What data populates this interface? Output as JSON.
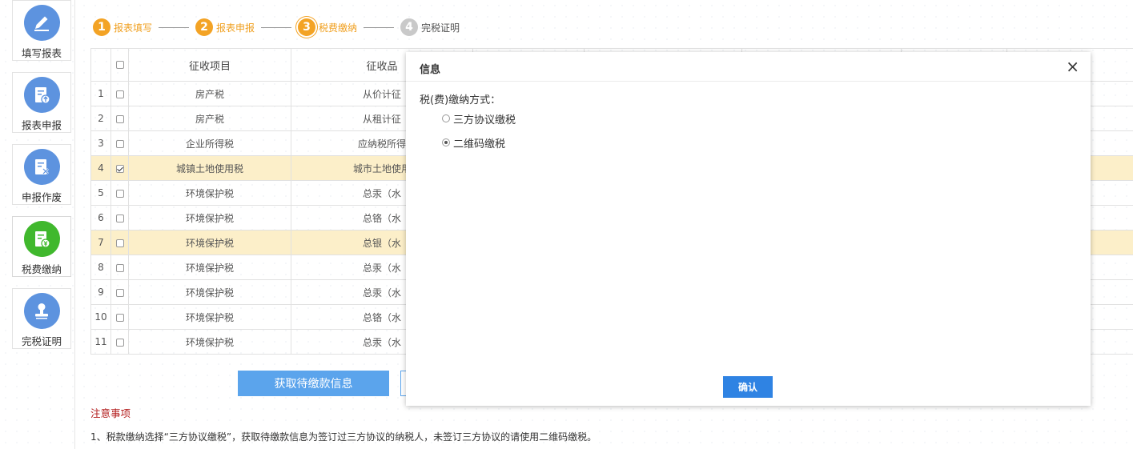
{
  "sidebar": {
    "items": [
      {
        "label": "填写报表",
        "icon": "pen-icon"
      },
      {
        "label": "报表申报",
        "icon": "upload-report-icon"
      },
      {
        "label": "申报作废",
        "icon": "void-report-icon"
      },
      {
        "label": "税费缴纳",
        "icon": "tax-payment-icon"
      },
      {
        "label": "完税证明",
        "icon": "stamp-icon"
      }
    ]
  },
  "steps": [
    {
      "num": "1",
      "label": "报表填写"
    },
    {
      "num": "2",
      "label": "报表申报"
    },
    {
      "num": "3",
      "label": "税费缴纳"
    },
    {
      "num": "4",
      "label": "完税证明"
    }
  ],
  "table": {
    "headers": [
      "征收项目",
      "征收品"
    ],
    "rows": [
      {
        "no": "1",
        "item": "房产税",
        "product": "从价计征"
      },
      {
        "no": "2",
        "item": "房产税",
        "product": "从租计征"
      },
      {
        "no": "3",
        "item": "企业所得税",
        "product": "应纳税所得"
      },
      {
        "no": "4",
        "item": "城镇土地使用税",
        "product": "城市土地使用"
      },
      {
        "no": "5",
        "item": "环境保护税",
        "product": "总汞（水"
      },
      {
        "no": "6",
        "item": "环境保护税",
        "product": "总铬（水"
      },
      {
        "no": "7",
        "item": "环境保护税",
        "product": "总银（水"
      },
      {
        "no": "8",
        "item": "环境保护税",
        "product": "总汞（水"
      },
      {
        "no": "9",
        "item": "环境保护税",
        "product": "总汞（水"
      },
      {
        "no": "10",
        "item": "环境保护税",
        "product": "总铬（水"
      },
      {
        "no": "11",
        "item": "环境保护税",
        "product": "总汞（水"
      }
    ]
  },
  "actions": {
    "fetch_label": "获取待缴款信息"
  },
  "notice": {
    "title": "注意事项",
    "text": "1、税款缴纳选择“三方协议缴税”，获取待缴款信息为签订过三方协议的纳税人，未签订三方协议的请使用二维码缴税。"
  },
  "modal": {
    "title": "信息",
    "close": "×",
    "label": "税(费)缴纳方式：",
    "options": [
      "三方协议缴税",
      "二维码缴税"
    ],
    "selected_option": "二维码缴税",
    "confirm_label": "确认"
  },
  "colors": {
    "accent": "#5ba4ec",
    "step": "#f3a325",
    "active_nav": "#40b82d",
    "nav": "#5d93df",
    "highlight_row": "#fcefc9",
    "notice": "#b21a1a"
  }
}
